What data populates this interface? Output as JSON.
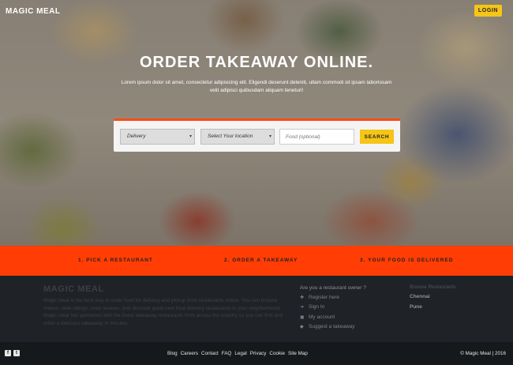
{
  "header": {
    "brand": "MAGIC MEAL",
    "login_label": "LOGIN"
  },
  "hero": {
    "title": "ORDER TAKEAWAY ONLINE.",
    "subtitle": "Lorem ipsum dolor sit amet, consectetur adipisicing elit. Eligendi deserunt deleniti, ullam commodi sit ipsam laboriosam velit adipisci quibusdam aliquam teneturi!"
  },
  "search": {
    "order_type": "Delivery",
    "location": "Select Your location",
    "food_placeholder": "Food (optional)",
    "button_label": "SEARCH"
  },
  "steps": [
    "1. PICK A RESTAURANT",
    "2. ORDER A TAKEAWAY",
    "3. YOUR FOOD IS DELIVERED"
  ],
  "footer": {
    "brand": "MAGIC MEAL",
    "description": "Magic meal is the best way to order food for delivery and pickup from restaurants online. You can browse menus, view ratings, read reviews, and discover great new food delivery restaurants in your neighborhood. Magic meal has partnered with the finest takeaway restaurants from across the country so you can find and order a delicious takeaway in minutes.",
    "owner_question": "Are you a restaurant owner ?",
    "owner_links": [
      {
        "label": "Register here",
        "icon": "user-plus-icon"
      },
      {
        "label": "Sign In",
        "icon": "sign-in-icon"
      },
      {
        "label": "My account",
        "icon": "briefcase-icon"
      },
      {
        "label": "Suggest a takeaway",
        "icon": "bell-icon"
      }
    ],
    "browse_title": "Browse Restaurants",
    "cities": [
      "Chennai",
      "Pune"
    ]
  },
  "bottom": {
    "links": [
      "Blog",
      "Careers",
      "Contact",
      "FAQ",
      "Legal",
      "Privacy",
      "Cookie",
      "Site Map"
    ],
    "copyright": "© Magic Meal | 2016",
    "social": [
      "facebook-icon",
      "twitter-icon"
    ]
  },
  "colors": {
    "accent_yellow": "#f5c518",
    "accent_orange": "#ff3d05",
    "footer_dark": "#1f2226"
  }
}
